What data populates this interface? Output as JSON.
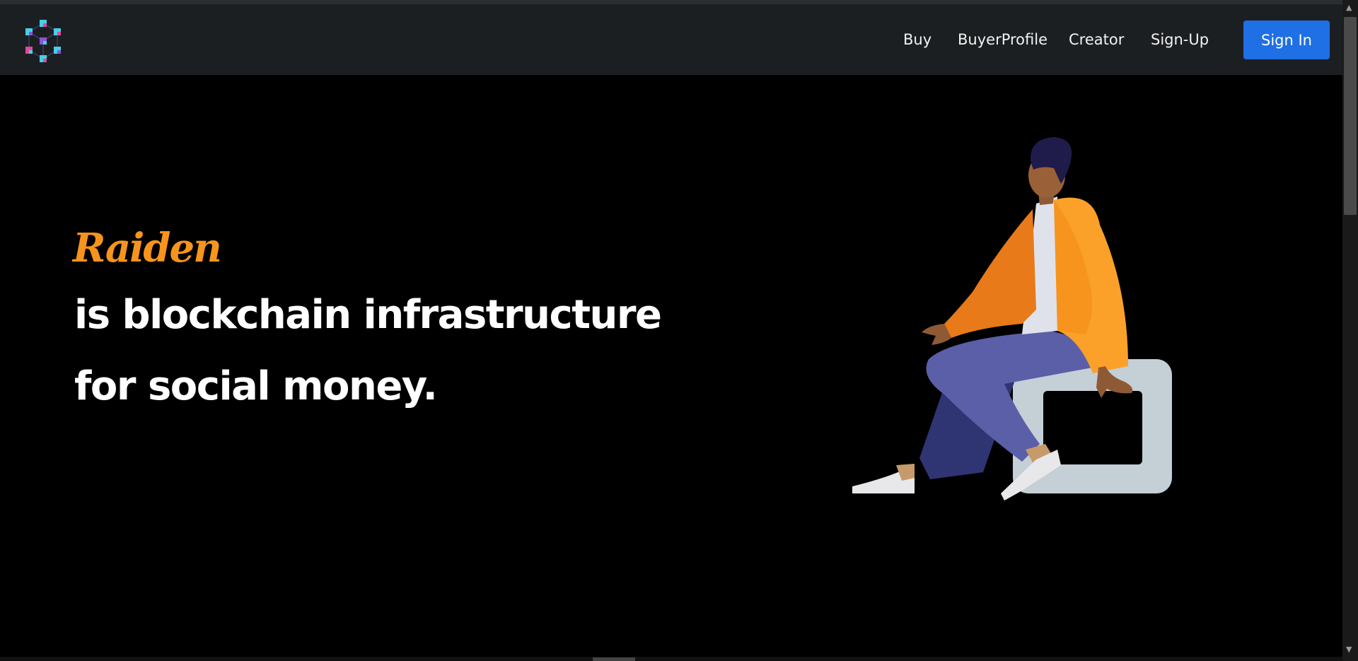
{
  "navbar": {
    "links": [
      "Buy",
      "BuyerProfile",
      "Creator",
      "Sign-Up"
    ],
    "signin_label": "Sign In"
  },
  "hero": {
    "brand": "Raiden",
    "line1": "is blockchain infrastructure",
    "line2": "for social money."
  },
  "colors": {
    "accent": "#f7941d",
    "primary_button": "#1f6fe5",
    "navbar_bg": "#1c1f22",
    "page_bg": "#000000"
  },
  "icons": [
    "blockchain-cubes-logo-icon",
    "sitting-person-illustration"
  ]
}
